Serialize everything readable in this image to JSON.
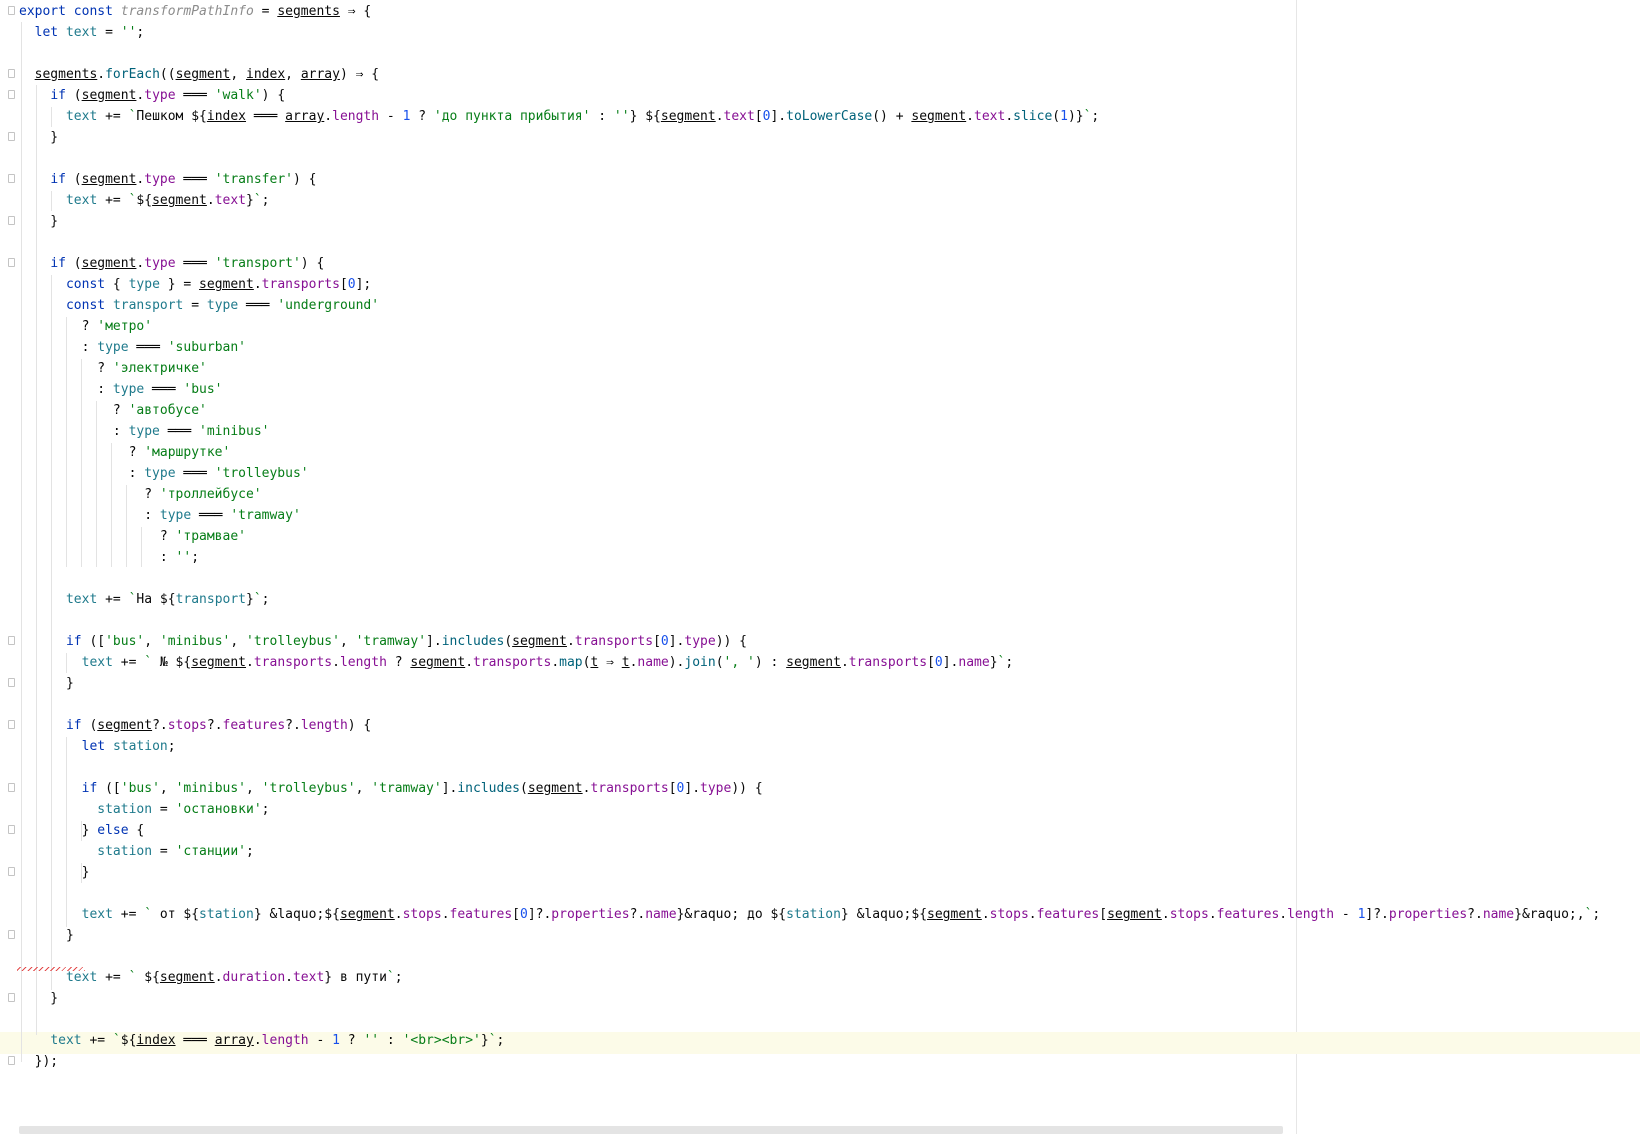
{
  "lines": [
    "export const transformPathInfo = segments ⇒ {",
    "  let text = '';",
    "",
    "  segments.forEach((segment, index, array) ⇒ {",
    "    if (segment.type ═══ 'walk') {",
    "      text += `Пешком ${index ═══ array.length - 1 ? 'до пункта прибытия' : ''} ${segment.text[0].toLowerCase() + segment.text.slice(1)}`;",
    "    }",
    "",
    "    if (segment.type ═══ 'transfer') {",
    "      text += `${segment.text}`;",
    "    }",
    "",
    "    if (segment.type ═══ 'transport') {",
    "      const { type } = segment.transports[0];",
    "      const transport = type ═══ 'underground'",
    "        ? 'метро'",
    "        : type ═══ 'suburban'",
    "          ? 'электричке'",
    "          : type ═══ 'bus'",
    "            ? 'автобусе'",
    "            : type ═══ 'minibus'",
    "              ? 'маршрутке'",
    "              : type ═══ 'trolleybus'",
    "                ? 'троллейбусе'",
    "                : type ═══ 'tramway'",
    "                  ? 'трамвае'",
    "                  : '';",
    "",
    "      text += `На ${transport}`;",
    "",
    "      if (['bus', 'minibus', 'trolleybus', 'tramway'].includes(segment.transports[0].type)) {",
    "        text += ` № ${segment.transports.length ? segment.transports.map(t ⇒ t.name).join(', ') : segment.transports[0].name}`;",
    "      }",
    "",
    "      if (segment?.stops?.features?.length) {",
    "        let station;",
    "",
    "        if (['bus', 'minibus', 'trolleybus', 'tramway'].includes(segment.transports[0].type)) {",
    "          station = 'остановки';",
    "        } else {",
    "          station = 'станции';",
    "        }",
    "",
    "        text += ` от ${station} &laquo;${segment.stops.features[0]?.properties?.name}&raquo; до ${station} &laquo;${segment.stops.features[segment.stops.features.length - 1]?.properties?.name}&raquo;,`;",
    "      }",
    "",
    "      text += ` ${segment.duration.text} в пути`;",
    "    }",
    "",
    "    text += `${index ═══ array.length - 1 ? '' : '<br><br>'}`;",
    "  });"
  ],
  "current_line_index": 49
}
